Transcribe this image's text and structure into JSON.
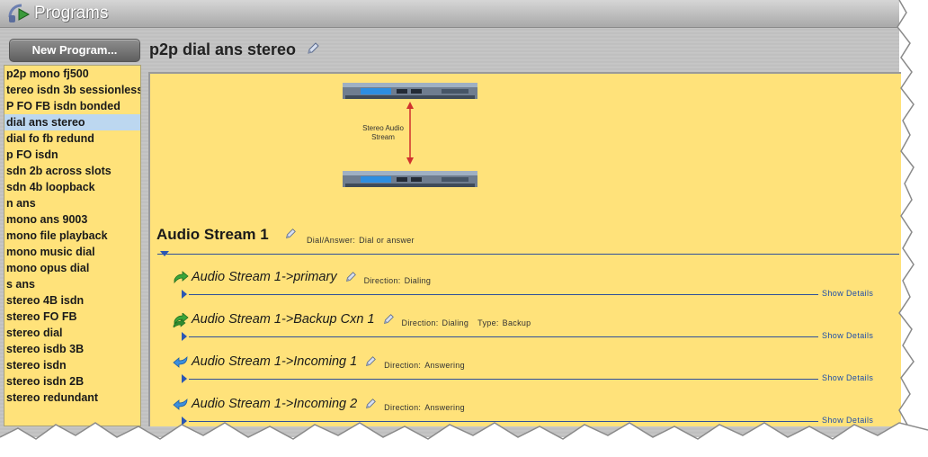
{
  "window": {
    "title": "Programs"
  },
  "sidebar": {
    "new_program_label": "New Program...",
    "selected_index": 3,
    "items": [
      "p2p mono fj500",
      "tereo isdn 3b sessionless",
      "P FO FB isdn bonded",
      "dial ans stereo",
      "dial fo fb redund",
      "p FO isdn",
      "sdn 2b across slots",
      "sdn 4b loopback",
      "n ans",
      "mono ans 9003",
      "mono file playback",
      "mono music dial",
      "mono opus dial",
      "s ans",
      "stereo 4B isdn",
      "stereo FO FB",
      "stereo dial",
      "stereo isdb 3B",
      "stereo isdn",
      "stereo isdn 2B",
      "stereo redundant"
    ]
  },
  "program": {
    "name": "p2p dial ans stereo",
    "diagram_label": "Stereo Audio Stream",
    "section": {
      "title": "Audio Stream 1",
      "kv_label": "Dial/Answer:",
      "kv_value": "Dial or answer"
    },
    "show_details_label": "Show Details",
    "connections": [
      {
        "title": "Audio Stream 1->primary",
        "direction_label": "Direction:",
        "direction": "Dialing",
        "type_label": "",
        "type": "",
        "icon": "dial-arrow-icon"
      },
      {
        "title": "Audio Stream 1->Backup Cxn 1",
        "direction_label": "Direction:",
        "direction": "Dialing",
        "type_label": "Type:",
        "type": "Backup",
        "icon": "backup-dial-icon"
      },
      {
        "title": "Audio Stream 1->Incoming 1",
        "direction_label": "Direction:",
        "direction": "Answering",
        "type_label": "",
        "type": "",
        "icon": "answer-arrow-icon"
      },
      {
        "title": "Audio Stream 1->Incoming 2",
        "direction_label": "Direction:",
        "direction": "Answering",
        "type_label": "",
        "type": "",
        "icon": "answer-arrow-icon"
      }
    ]
  },
  "colors": {
    "panel": "#ffe27a",
    "selection": "#bcd7f0",
    "accent": "#2a56b3",
    "arrow": "#d0312d"
  }
}
